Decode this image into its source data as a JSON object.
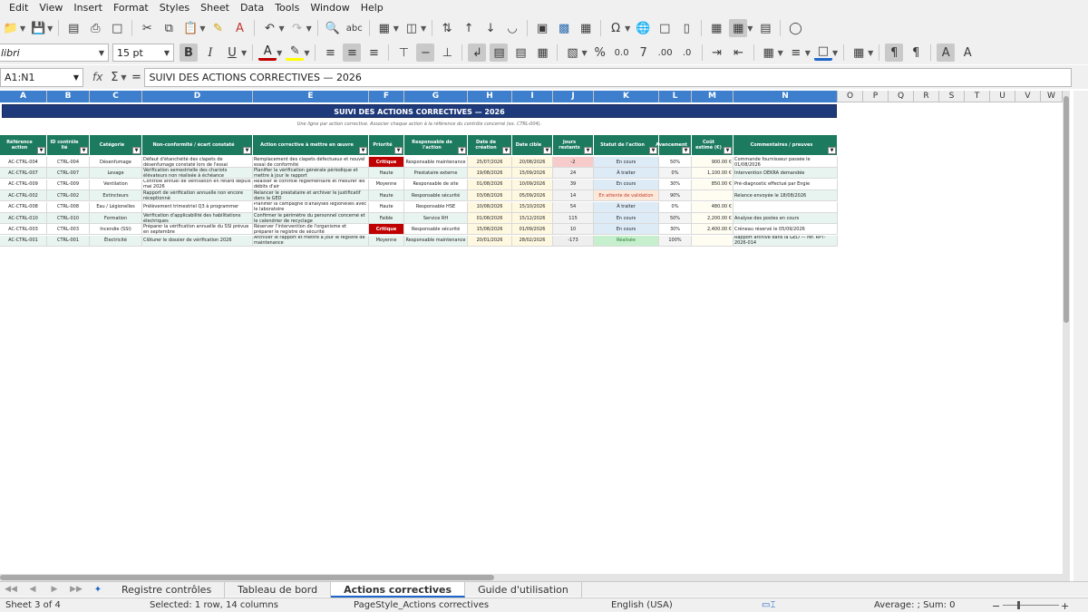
{
  "menu": [
    "Edit",
    "View",
    "Insert",
    "Format",
    "Styles",
    "Sheet",
    "Data",
    "Tools",
    "Window",
    "Help"
  ],
  "font": {
    "name": "libri",
    "size": "15 pt"
  },
  "formula": {
    "namebox": "A1:N1",
    "content": "SUIVI DES ACTIONS CORRECTIVES — 2026"
  },
  "columns": [
    "A",
    "B",
    "C",
    "D",
    "E",
    "F",
    "G",
    "H",
    "I",
    "J",
    "K",
    "L",
    "M",
    "N",
    "O",
    "P",
    "Q",
    "R",
    "S",
    "T",
    "U",
    "V",
    "W"
  ],
  "sheet": {
    "title": "SUIVI DES ACTIONS CORRECTIVES — 2026",
    "subtitle": "Une ligne par action corrective. Associer chaque action à la référence du contrôle concerné (ex. CTRL-004).",
    "headers": [
      "Référence action",
      "ID contrôle lié",
      "Catégorie",
      "Non-conformité / écart constaté",
      "Action corrective à mettre en œuvre",
      "Priorité",
      "Responsable de l'action",
      "Date de création",
      "Date cible",
      "Jours restants",
      "Statut de l'action",
      "Avancement",
      "Coût estimé (€)",
      "Commentaires / preuves"
    ],
    "rows": [
      [
        "AC-CTRL-004",
        "CTRL-004",
        "Désenfumage",
        "Défaut d'étanchéité des clapets de désenfumage constaté lors de l'essai",
        "Remplacement des clapets défectueux et nouvel essai de conformité",
        "Critique",
        "Responsable maintenance",
        "25/07/2026",
        "20/08/2026",
        "-2",
        "En cours",
        "50%",
        "900.00 €",
        "Commande fournisseur passée le 01/08/2026"
      ],
      [
        "AC-CTRL-007",
        "CTRL-007",
        "Levage",
        "Vérification semestrielle des chariots élévateurs non réalisée à échéance",
        "Planifier la vérification générale périodique et mettre à jour le rapport",
        "Haute",
        "Prestataire externe",
        "19/08/2026",
        "15/09/2026",
        "24",
        "À traiter",
        "0%",
        "1,100.00 €",
        "Intervention DEKRA demandée"
      ],
      [
        "AC-CTRL-009",
        "CTRL-009",
        "Ventilation",
        "Contrôle annuel de ventilation en retard depuis mai 2026",
        "Réaliser le contrôle réglementaire et mesurer les débits d'air",
        "Moyenne",
        "Responsable de site",
        "01/08/2026",
        "10/09/2026",
        "39",
        "En cours",
        "30%",
        "850.00 €",
        "Pré-diagnostic effectué par Engie"
      ],
      [
        "AC-CTRL-002",
        "CTRL-002",
        "Extincteurs",
        "Rapport de vérification annuelle non encore réceptionné",
        "Relancer le prestataire et archiver le justificatif dans la GED",
        "Haute",
        "Responsable sécurité",
        "03/08/2026",
        "05/09/2026",
        "14",
        "En attente de validation",
        "90%",
        "",
        "Relance envoyée le 18/08/2026"
      ],
      [
        "AC-CTRL-008",
        "CTRL-008",
        "Eau / Légionelles",
        "Prélèvement trimestriel Q3 à programmer",
        "Planifier la campagne d'analyses légionelles avec le laboratoire",
        "Haute",
        "Responsable HSE",
        "10/08/2026",
        "15/10/2026",
        "54",
        "À traiter",
        "0%",
        "480.00 €",
        ""
      ],
      [
        "AC-CTRL-010",
        "CTRL-010",
        "Formation",
        "Vérification d'applicabilité des habilitations électriques",
        "Confirmer le périmètre du personnel concerné et le calendrier de recyclage",
        "Faible",
        "Service RH",
        "01/08/2026",
        "15/12/2026",
        "115",
        "En cours",
        "50%",
        "2,200.00 €",
        "Analyse des postes en cours"
      ],
      [
        "AC-CTRL-003",
        "CTRL-003",
        "Incendie (SSI)",
        "Préparer la vérification annuelle du SSI prévue en septembre",
        "Réserver l'intervention de l'organisme et préparer le registre de sécurité",
        "Critique",
        "Responsable sécurité",
        "15/08/2026",
        "01/09/2026",
        "10",
        "En cours",
        "30%",
        "2,400.00 €",
        "Créneau réservé le 05/09/2026"
      ],
      [
        "AC-CTRL-001",
        "CTRL-001",
        "Électricité",
        "Clôturer le dossier de vérification 2026",
        "Archiver le rapport et mettre à jour le registre de maintenance",
        "Moyenne",
        "Responsable maintenance",
        "20/01/2026",
        "28/02/2026",
        "-173",
        "Réalisée",
        "100%",
        "",
        "Rapport archivé dans la GED — réf. RPT-2026-014"
      ]
    ]
  },
  "colors": {
    "banner": "#1f3a7a",
    "header": "#1c7a5e",
    "stripe": "#e8f4ef",
    "critique": "#c00000",
    "status_blue": "#ddebf7",
    "status_orange": "#fde9d9",
    "status_green": "#c6efce",
    "date_fill": "#fff8e1"
  },
  "tabs": [
    "Registre contrôles",
    "Tableau de bord",
    "Actions correctives",
    "Guide d'utilisation"
  ],
  "status": {
    "sheet": "Sheet 3 of 4",
    "selection": "Selected: 1 row, 14 columns",
    "page_style": "PageStyle_Actions correctives",
    "language": "English (USA)",
    "summary": "Average: ; Sum: 0"
  }
}
